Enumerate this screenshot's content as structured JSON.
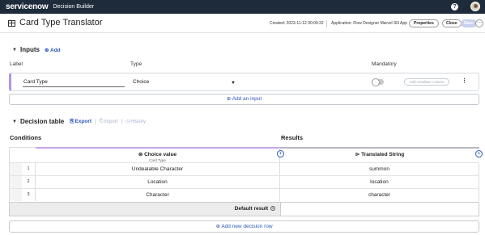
{
  "topbar": {
    "brand": "servicenow",
    "app_name": "Decision Builder",
    "help": "?"
  },
  "header": {
    "title": "Card Type Translator",
    "created": "Created: 2023-11-12 00:09:32",
    "application": "Application: Flow Designer Marvel SN App",
    "properties_label": "Properties",
    "close_label": "Close",
    "save_label": "Save",
    "more_label": "···"
  },
  "inputs": {
    "title": "Inputs",
    "add_label": "⊕ Add",
    "columns": {
      "label": "Label",
      "type": "Type",
      "mandatory": "Mandatory"
    },
    "row": {
      "name": "Card Type",
      "type": "Choice",
      "mandatory": false,
      "condition_label": "Add condition column"
    },
    "add_input_label": "⊕ Add an input"
  },
  "decision_table": {
    "title": "Decision table",
    "export_label": "Export",
    "import_label": "Import",
    "history_label": "History",
    "conditions_label": "Conditions",
    "results_label": "Results",
    "choice_column": {
      "title": "Choice value",
      "subtitle": "Card Type"
    },
    "result_column": {
      "title": "Translated String"
    },
    "rows": [
      {
        "num": "1",
        "choice": "Undealable Character",
        "result": "summon"
      },
      {
        "num": "2",
        "choice": "Location",
        "result": "location"
      },
      {
        "num": "3",
        "choice": "Character",
        "result": "character"
      }
    ],
    "default_result_label": "Default result",
    "add_row_label": "⊕ Add new decision row"
  },
  "colors": {
    "topbar": "#1e2b3a",
    "accent": "#2d57b8",
    "input_stripe": "#b196e6"
  }
}
